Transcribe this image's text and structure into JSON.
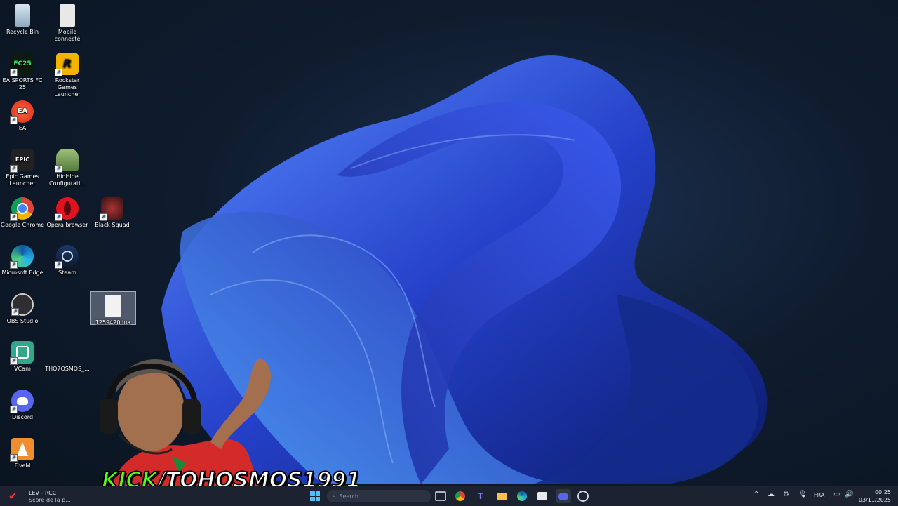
{
  "desktop": {
    "icons": [
      {
        "label": "Recycle Bin",
        "icon": "recycle-bin-icon"
      },
      {
        "label": "Mobile connecté",
        "icon": "file-icon"
      },
      {
        "label": "EA SPORTS FC 25",
        "icon": "fc25-icon",
        "badge": "FC25"
      },
      {
        "label": "Rockstar Games Launcher",
        "icon": "rockstar-icon",
        "badge": "R"
      },
      {
        "label": "EA",
        "icon": "ea-icon",
        "badge": "EA"
      },
      {
        "label": "Epic Games Launcher",
        "icon": "epic-games-icon",
        "badge": "EPIC"
      },
      {
        "label": "HidHide Configurati...",
        "icon": "hidhide-icon"
      },
      {
        "label": "Google Chrome",
        "icon": "chrome-icon"
      },
      {
        "label": "Opera browser",
        "icon": "opera-icon"
      },
      {
        "label": "Black Squad",
        "icon": "black-squad-icon"
      },
      {
        "label": "Microsoft Edge",
        "icon": "edge-icon"
      },
      {
        "label": "Steam",
        "icon": "steam-icon"
      },
      {
        "label": "OBS Studio",
        "icon": "obs-icon"
      },
      {
        "label": "1259420.lua",
        "icon": "lua-file-icon"
      },
      {
        "label": "VCam",
        "icon": "vcam-icon"
      },
      {
        "label": "THO7OSMOS_...",
        "icon": "blank-file-icon"
      },
      {
        "label": "Discord",
        "icon": "discord-icon"
      },
      {
        "label": "FiveM",
        "icon": "fivem-icon"
      }
    ]
  },
  "overlay": {
    "kick_word": "KICK",
    "channel": "/TOHOSMOS1991"
  },
  "taskbar": {
    "weather_title": "LEV - RCC",
    "weather_sub": "Score de la p...",
    "search_placeholder": "Search",
    "language": "FRA",
    "time": "00:25",
    "date": "03/11/2025"
  },
  "colors": {
    "kick_green": "#53fc18",
    "taskbar": "#1c2230"
  }
}
